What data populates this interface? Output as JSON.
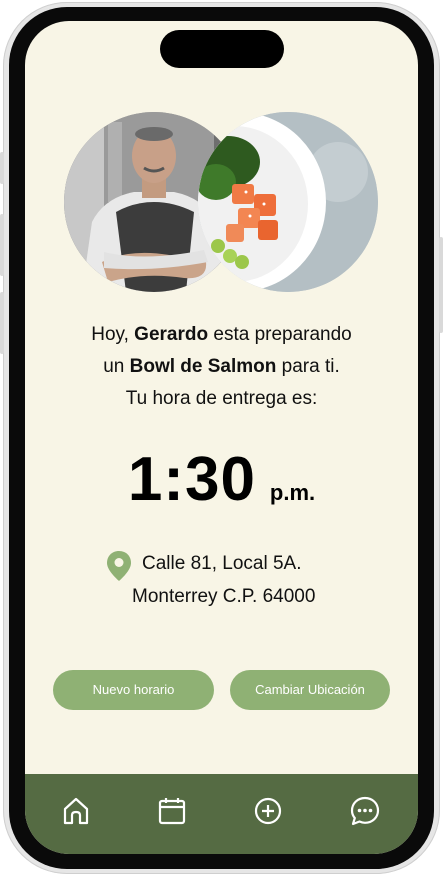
{
  "greeting": {
    "prefix": "Hoy, ",
    "chef_name": "Gerardo",
    "middle": " esta preparando",
    "line2_prefix": "un ",
    "dish": "Bowl de Salmon",
    "line2_suffix": " para ti.",
    "line3": "Tu hora de entrega es:"
  },
  "delivery_time": {
    "time": "1:30",
    "period": "p.m."
  },
  "address": {
    "line1": "Calle 81, Local 5A.",
    "line2": "Monterrey C.P. 64000",
    "icon": "location-pin-icon"
  },
  "actions": {
    "new_time": "Nuevo horario",
    "change_location": "Cambiar Ubicación"
  },
  "nav": {
    "items": [
      "home-icon",
      "calendar-icon",
      "add-icon",
      "chat-icon"
    ]
  },
  "colors": {
    "background": "#f8f5e6",
    "button": "#8fb174",
    "nav_bar": "#556b43",
    "pin": "#8fb174"
  }
}
